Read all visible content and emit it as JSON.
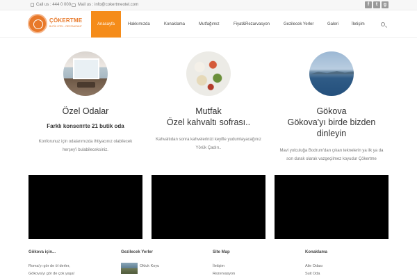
{
  "topbar": {
    "phone": "Call us : 444 0 000",
    "mail": "Mail us : info@cokertmeotel.com",
    "social": [
      "f",
      "t",
      "g"
    ]
  },
  "logo": {
    "brand": "ÇÖKERTME",
    "tagline": "BUTİK OTEL - RESTAURANT"
  },
  "nav": {
    "items": [
      "Anasayfa",
      "Hakkımızda",
      "Konaklama",
      "Mutfağımız",
      "Fiyat&Rezarvasyon",
      "Gezilecek Yerler",
      "Galeri",
      "İletişim"
    ],
    "active_index": 0
  },
  "features": [
    {
      "image": "room-photo",
      "title": "Özel Odalar",
      "subtitle": "Farklı konsептte 21 butik oda",
      "desc_lines": [
        "Konforunuz için odalarımızda ihtiyacınız olabilecek",
        "herşey'i bulabileceksiniz."
      ]
    },
    {
      "image": "breakfast-photo",
      "title": "Mutfak",
      "subtitle": "Özel kahvaltı sofrası..",
      "desc_lines": [
        "Kahvaltıdan sonra kahvelerinizi keyifle yudumlayacağınız",
        "Yörük Çadırı.."
      ]
    },
    {
      "image": "sea-photo",
      "title": "Gökova",
      "subtitle_lines": [
        "Gökova'yı birde bizden",
        "dinleyin"
      ],
      "desc_lines": [
        "Mavi yolculuğa Bodrum'dan çıkan teknelerin ya ilk ya da",
        "son durak olarak vazgeçilmez koyudur Çökertme"
      ]
    }
  ],
  "footer": {
    "col1": {
      "heading": "Gökova için...",
      "lines": [
        "Roma'yı gör de öl derler,",
        "Gökova'yı gör de çok yaşa!"
      ]
    },
    "col2": {
      "heading": "Gezilecek Yerler",
      "post": "Okluk Koyu"
    },
    "col3": {
      "heading": "Site Map",
      "links": [
        "İletişim",
        "Rezervasyon"
      ]
    },
    "col4": {
      "heading": "Konaklama",
      "links": [
        "Aile Odası",
        "Suit Oda"
      ]
    }
  }
}
